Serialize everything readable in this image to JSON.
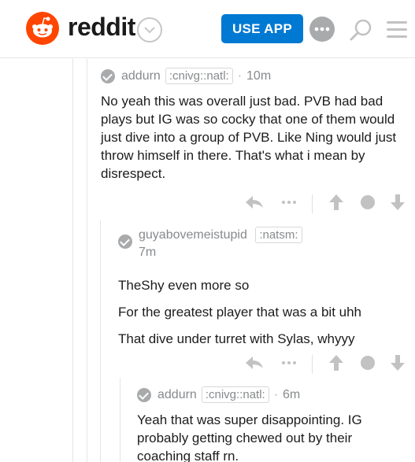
{
  "header": {
    "brand": "reddit",
    "use_app_label": "USE APP"
  },
  "comments": [
    {
      "author": "addurn",
      "flair": ":cnivg::natl:",
      "time": "10m",
      "paragraphs": [
        "No yeah this was overall just bad. PVB had bad plays but IG was so cocky that one of them would just dive into a group of PVB. Like Ning would just throw himself in there. That's what i mean by disrespect."
      ]
    },
    {
      "author": "guyabovemeistupid",
      "flair": ":natsm:",
      "time": "7m",
      "paragraphs": [
        "TheShy even more so",
        "For the greatest player that was a bit uhh",
        "That dive under turret with Sylas, whyyy"
      ]
    },
    {
      "author": "addurn",
      "flair": ":cnivg::natl:",
      "time": "6m",
      "paragraphs": [
        "Yeah that was super disappointing. IG probably getting chewed out by their coaching staff rn."
      ]
    }
  ],
  "icons": {
    "brand_color": "#ff4500",
    "use_app_color": "#0079d3"
  }
}
